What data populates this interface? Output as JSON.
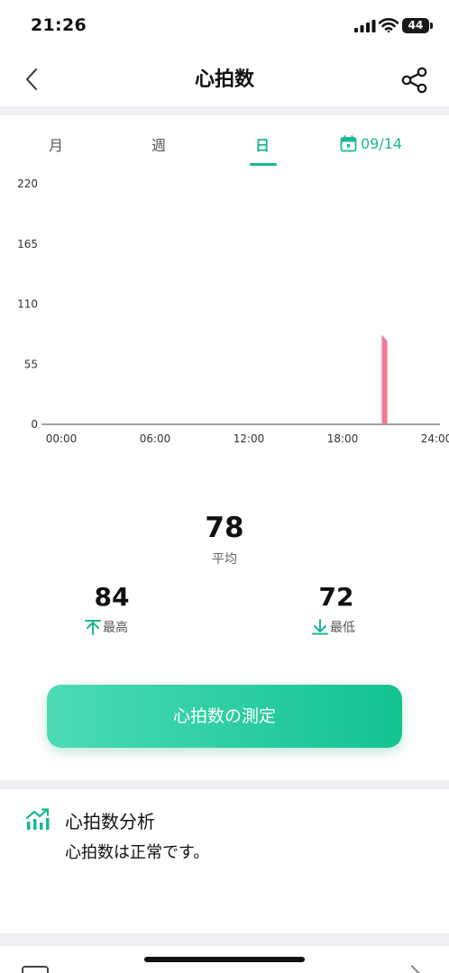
{
  "status": {
    "time": "21:26",
    "battery": "44"
  },
  "nav": {
    "title": "心拍数"
  },
  "tabs": [
    {
      "label": "月"
    },
    {
      "label": "週"
    },
    {
      "label": "日"
    }
  ],
  "date": "09/14",
  "chart_data": {
    "type": "area",
    "y_ticks": [
      "220",
      "165",
      "110",
      "55",
      "0"
    ],
    "x_ticks": [
      "00:00",
      "06:00",
      "12:00",
      "18:00",
      "24:00"
    ],
    "ylim": [
      0,
      220
    ],
    "xlim": [
      0,
      24
    ],
    "x_unit": "hours",
    "series": [
      {
        "color": "#f07a96",
        "x": [
          21.55,
          21.55,
          21.9,
          21.9
        ],
        "y": [
          0,
          82,
          76,
          0
        ]
      }
    ]
  },
  "stats": {
    "avg_value": "78",
    "avg_label": "平均",
    "max_value": "84",
    "max_label": "最高",
    "min_value": "72",
    "min_label": "最低"
  },
  "button": {
    "measure_label": "心拍数の測定"
  },
  "analysis": {
    "title": "心拍数分析",
    "text": "心拍数は正常です。"
  },
  "colors": {
    "accent": "#19b894",
    "band": "#eef0f3"
  }
}
